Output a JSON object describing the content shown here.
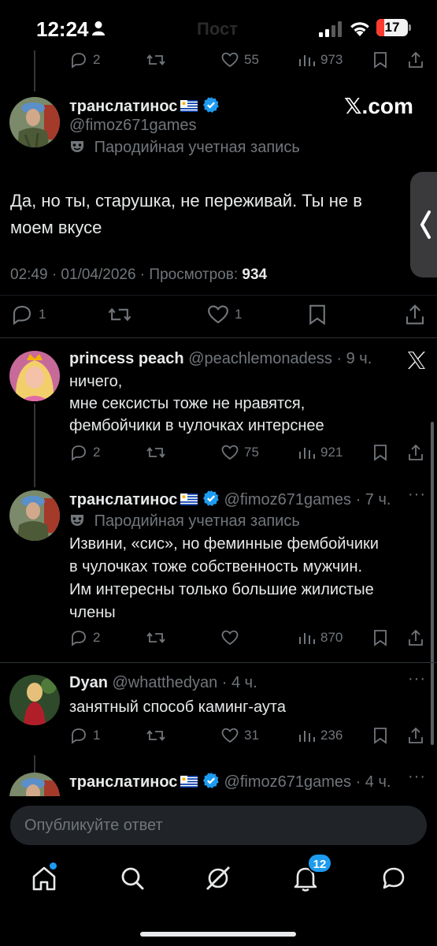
{
  "status_bar": {
    "time": "12:24",
    "battery": "17",
    "ghost_title": "Пост"
  },
  "top_actions": {
    "replies": "2",
    "likes": "55",
    "views": "973"
  },
  "main_tweet": {
    "display_name": "транслатинос",
    "handle": "@fimoz671games",
    "parody_label": "Пародийная учетная запись",
    "watermark": "𝕏.com",
    "text_line1": "Да, но ты, старушка, не переживай. Ты не в",
    "text_line2": "моем вкусе",
    "meta_datetime": "02:49 · 01/04/2026 · Просмотров:",
    "meta_views": "934",
    "replies": "1",
    "likes": "1"
  },
  "replies": [
    {
      "display_name": "princess peach",
      "handle": "@peachlemonadess",
      "time": "· 9 ч.",
      "lines": [
        "ничего,",
        "мне сексисты тоже не нравятся,",
        "фембойчики в чулочках интерснее"
      ],
      "replies": "2",
      "likes": "75",
      "views": "921"
    },
    {
      "display_name": "транслатинос",
      "handle": "@fimoz671games",
      "time": "· 7 ч.",
      "parody_label": "Пародийная учетная запись",
      "lines": [
        "Извини, «сис», но феминные фембойчики",
        "в чулочках тоже собственность мужчин.",
        "Им интересны только большие жилистые",
        "члены"
      ],
      "replies": "2",
      "likes": "",
      "views": "870"
    },
    {
      "display_name": "Dyan",
      "handle": "@whatthedyan",
      "time": "· 4 ч.",
      "lines": [
        "занятный способ каминг-аута"
      ],
      "replies": "1",
      "likes": "31",
      "views": "236"
    },
    {
      "display_name": "транслатинос",
      "handle": "@fimoz671games",
      "time": "· 4 ч."
    }
  ],
  "composer": {
    "placeholder": "Опубликуйте ответ"
  },
  "nav": {
    "notifications_badge": "12"
  },
  "colors": {
    "background": "#000000",
    "text": "#e7e9ea",
    "muted": "#71767b",
    "verified": "#1d9bf0",
    "badge": "#1d9bf0"
  }
}
